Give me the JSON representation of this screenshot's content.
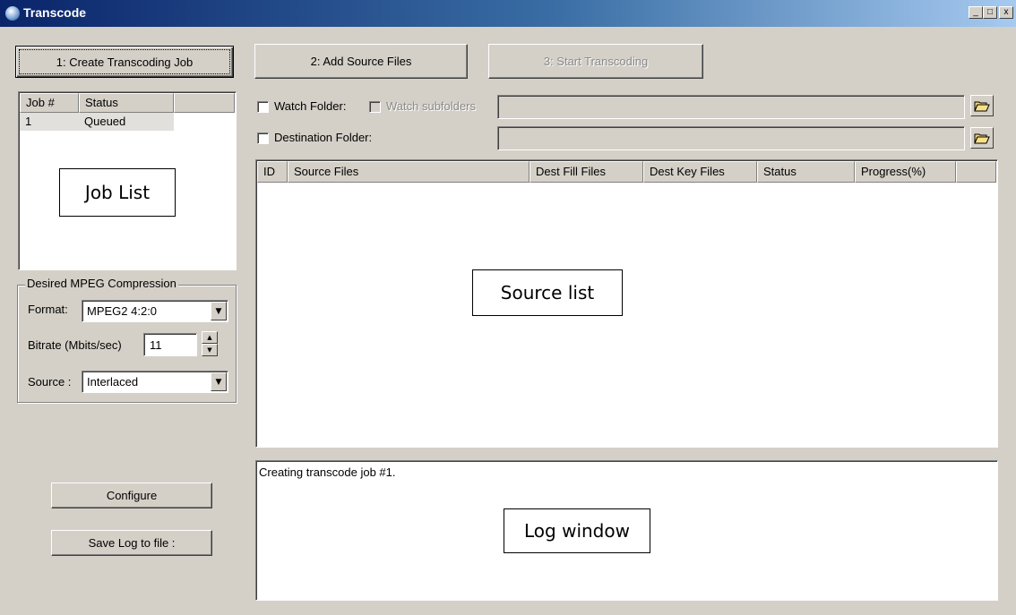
{
  "window": {
    "title": "Transcode",
    "controls": {
      "minimize": "_",
      "maximize": "□",
      "close": "x"
    }
  },
  "toolbar": {
    "create_job": "1: Create Transcoding Job",
    "add_source": "2: Add Source Files",
    "start_transcoding": "3: Start Transcoding"
  },
  "job_list": {
    "columns": [
      "Job #",
      "Status"
    ],
    "rows": [
      {
        "job": "1",
        "status": "Queued"
      }
    ],
    "annotation": "Job List"
  },
  "compression": {
    "group_label": "Desired MPEG Compression",
    "format_label": "Format:",
    "format_value": "MPEG2 4:2:0",
    "bitrate_label": "Bitrate (Mbits/sec)",
    "bitrate_value": "11",
    "source_label": "Source :",
    "source_value": "Interlaced"
  },
  "folders": {
    "watch_folder_label": "Watch Folder:",
    "watch_subfolders_label": "Watch subfolders",
    "destination_folder_label": "Destination Folder:",
    "watch_folder_value": "",
    "destination_folder_value": ""
  },
  "source_list": {
    "columns": [
      "ID",
      "Source Files",
      "Dest Fill Files",
      "Dest Key Files",
      "Status",
      "Progress(%)"
    ],
    "annotation": "Source list"
  },
  "log": {
    "text": "Creating transcode job #1.",
    "annotation": "Log window"
  },
  "bottom_buttons": {
    "configure": "Configure",
    "save_log": "Save Log to file :"
  },
  "icons": {
    "app": "app-globe-icon",
    "folder": "open-folder-icon",
    "dropdown": "chevron-down-icon",
    "spin_up": "spin-up-icon",
    "spin_down": "spin-down-icon"
  }
}
